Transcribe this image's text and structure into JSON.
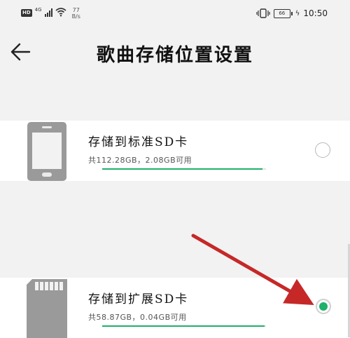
{
  "status_bar": {
    "hd": "HD",
    "network_type": "4G",
    "speed_value": "77",
    "speed_unit": "B/s",
    "battery": "66",
    "time": "10:50",
    "icons": [
      "hd-icon",
      "signal-icon",
      "wifi-icon",
      "vibrate-icon",
      "battery-icon",
      "charging-icon"
    ]
  },
  "header": {
    "title": "歌曲存储位置设置",
    "back_icon": "back-arrow-icon"
  },
  "options": [
    {
      "title": "存储到标准SD卡",
      "subtitle": "共112.28GB，2.08GB可用",
      "icon": "phone-icon",
      "selected": false,
      "used_fraction": 0.98
    },
    {
      "title": "存储到扩展SD卡",
      "subtitle": "共58.87GB，0.04GB可用",
      "icon": "sd-card-icon",
      "selected": true,
      "used_fraction": 0.99
    }
  ],
  "colors": {
    "accent": "#1fb06a",
    "annotation_arrow": "#c62828",
    "background": "#f2f2f2"
  }
}
